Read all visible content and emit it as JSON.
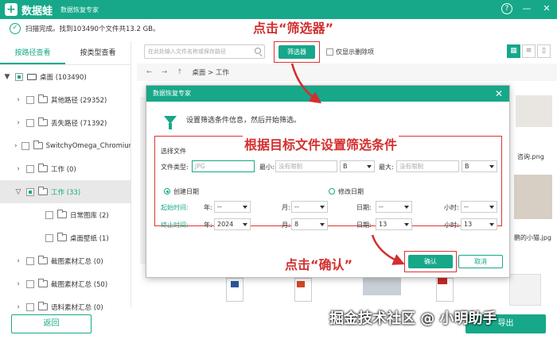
{
  "titlebar": {
    "logo_glyph": "+",
    "app_name": "数据蛙",
    "subtitle": "数据恢复专家",
    "help": "?",
    "minimize": "—",
    "close": "✕"
  },
  "scan": {
    "status_text": "扫描完成。找到103490个文件共13.2 GB。"
  },
  "left": {
    "tabs": [
      {
        "label": "按路径查看",
        "active": true
      },
      {
        "label": "按类型查看",
        "active": false
      }
    ],
    "tree": [
      {
        "label": "桌面 (103490)",
        "arrow": "▼",
        "indent": 0,
        "partial": true,
        "drive": true
      },
      {
        "label": "其他路径 (29352)",
        "arrow": "›",
        "indent": 1
      },
      {
        "label": "丢失路径 (71392)",
        "arrow": "›",
        "indent": 1
      },
      {
        "label": "SwitchyOmega_Chromium",
        "arrow": "›",
        "indent": 1
      },
      {
        "label": "工作 (0)",
        "arrow": "›",
        "indent": 1
      },
      {
        "label": "工作 (33)",
        "arrow": "▽",
        "indent": 1,
        "partial": true,
        "selected": true
      },
      {
        "label": "日常图库 (2)",
        "arrow": "",
        "indent": 2
      },
      {
        "label": "桌面壁纸 (1)",
        "arrow": "",
        "indent": 2
      },
      {
        "label": "截图素材汇总 (0)",
        "arrow": "›",
        "indent": 1
      },
      {
        "label": "截图素材汇总 (50)",
        "arrow": "›",
        "indent": 1
      },
      {
        "label": "语料素材汇总 (0)",
        "arrow": "›",
        "indent": 1
      }
    ]
  },
  "toolbar": {
    "search_placeholder": "在此处输入文件名称或保存路径",
    "filter_label": "筛选器",
    "show_deleted_label": "仅显示删除项",
    "view_icons": [
      "▦",
      "≡",
      "▯"
    ]
  },
  "breadcrumb": {
    "back": "←",
    "forward": "→",
    "up": "↑",
    "path": "桌面 > 工作"
  },
  "bg_files": {
    "file1": "咨询.png",
    "file2": "鹏的小猫.jpg"
  },
  "dialog": {
    "title": "数据恢复专家",
    "close": "✕",
    "info": "设置筛选条件信息，然后开始筛选。",
    "select_file": "选择文件",
    "file_type_label": "文件类型:",
    "file_type_placeholder": "JPG",
    "min_label": "最小:",
    "min_placeholder": "没有限制",
    "min_unit": "B",
    "max_label": "最大:",
    "max_placeholder": "没有限制",
    "max_unit": "B",
    "created_label": "创建日期",
    "modified_label": "修改日期",
    "start_label": "起始时间:",
    "end_label": "终止时间:",
    "year_label": "年:",
    "month_label": "月:",
    "day_label": "日期:",
    "hour_label": "小时:",
    "start": {
      "year": "--",
      "month": "--",
      "day": "--",
      "hour": "--"
    },
    "end": {
      "year": "2024",
      "month": "8",
      "day": "13",
      "hour": "13"
    },
    "ok_label": "确认",
    "cancel_label": "取消"
  },
  "annotations": {
    "click_filter": "点击“筛选器”",
    "set_conditions": "根据目标文件设置筛选条件",
    "click_ok": "点击“确认”"
  },
  "bottom": {
    "back_label": "返回",
    "export_label": "导出",
    "watermark": "掘金技术社区 @ 小明助手"
  },
  "colors": {
    "accent": "#16a889",
    "annotation": "#d32f2f"
  }
}
